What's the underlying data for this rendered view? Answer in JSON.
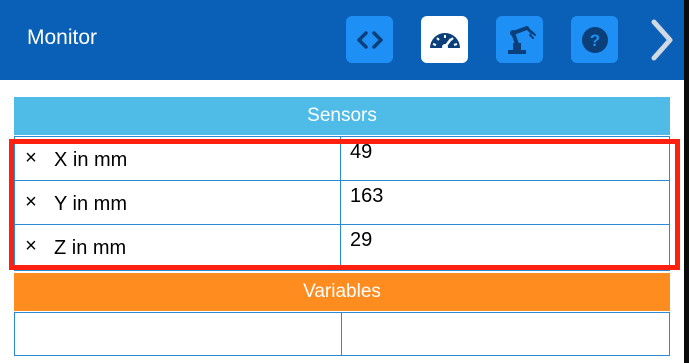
{
  "app": {
    "title": "Monitor"
  },
  "toolbar": {
    "buttons": [
      {
        "icon": "code-icon"
      },
      {
        "icon": "gauge-icon",
        "active": true
      },
      {
        "icon": "robot-arm-icon"
      },
      {
        "icon": "help-icon"
      }
    ],
    "next_icon": "chevron-right-icon"
  },
  "sensors": {
    "header": "Sensors",
    "rows": [
      {
        "remove_icon": "×",
        "label": "X in mm",
        "value": "49"
      },
      {
        "remove_icon": "×",
        "label": "Y in mm",
        "value": "163"
      },
      {
        "remove_icon": "×",
        "label": "Z in mm",
        "value": "29"
      }
    ]
  },
  "variables": {
    "header": "Variables",
    "rows": [
      {
        "name": "",
        "value": ""
      }
    ]
  },
  "colors": {
    "topbar": "#0a5fb6",
    "button": "#1e90f5",
    "sensors_header": "#4fbce8",
    "variables_header": "#ff8c1f",
    "highlight": "#ff2010"
  }
}
